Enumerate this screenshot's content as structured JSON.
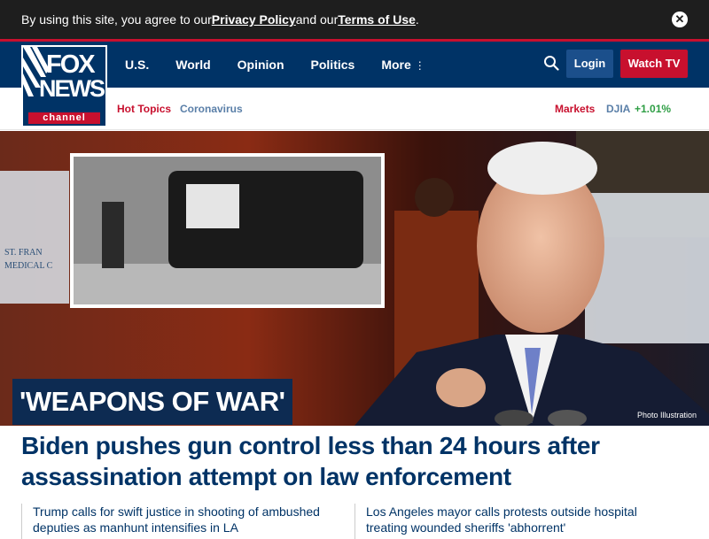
{
  "cookie_banner": {
    "prefix": "By using this site, you agree to our ",
    "privacy_link": "Privacy Policy",
    "middle": " and our ",
    "terms_link": "Terms of Use",
    "suffix": ".",
    "close_icon": "close-icon"
  },
  "header": {
    "logo": {
      "line1": "FOX",
      "line2": "NEWS",
      "line3": "channel"
    },
    "nav": [
      {
        "label": "U.S."
      },
      {
        "label": "World"
      },
      {
        "label": "Opinion"
      },
      {
        "label": "Politics"
      },
      {
        "label": "More",
        "icon": "vertical-dots-icon"
      }
    ],
    "search_icon": "search-icon",
    "login_label": "Login",
    "watch_tv_label": "Watch TV",
    "colors": {
      "navy": "#003366",
      "red": "#c8102e",
      "login_bg": "#1b4f8b"
    }
  },
  "subnav": {
    "hot_topics": "Hot Topics",
    "coronavirus": "Coronavirus",
    "markets": "Markets",
    "djia_label": "DJIA",
    "djia_change": "+1.01%"
  },
  "hero": {
    "label": "'WEAPONS OF WAR'",
    "photo_credit": "Photo Illustration",
    "headline": "Biden pushes gun control less than 24 hours after assassination attempt on law enforcement"
  },
  "stories": [
    {
      "text": "Trump calls for swift justice in shooting of ambushed deputies as manhunt intensifies in LA"
    },
    {
      "text": "Los Angeles mayor calls protests outside hospital treating wounded sheriffs 'abhorrent'"
    }
  ]
}
